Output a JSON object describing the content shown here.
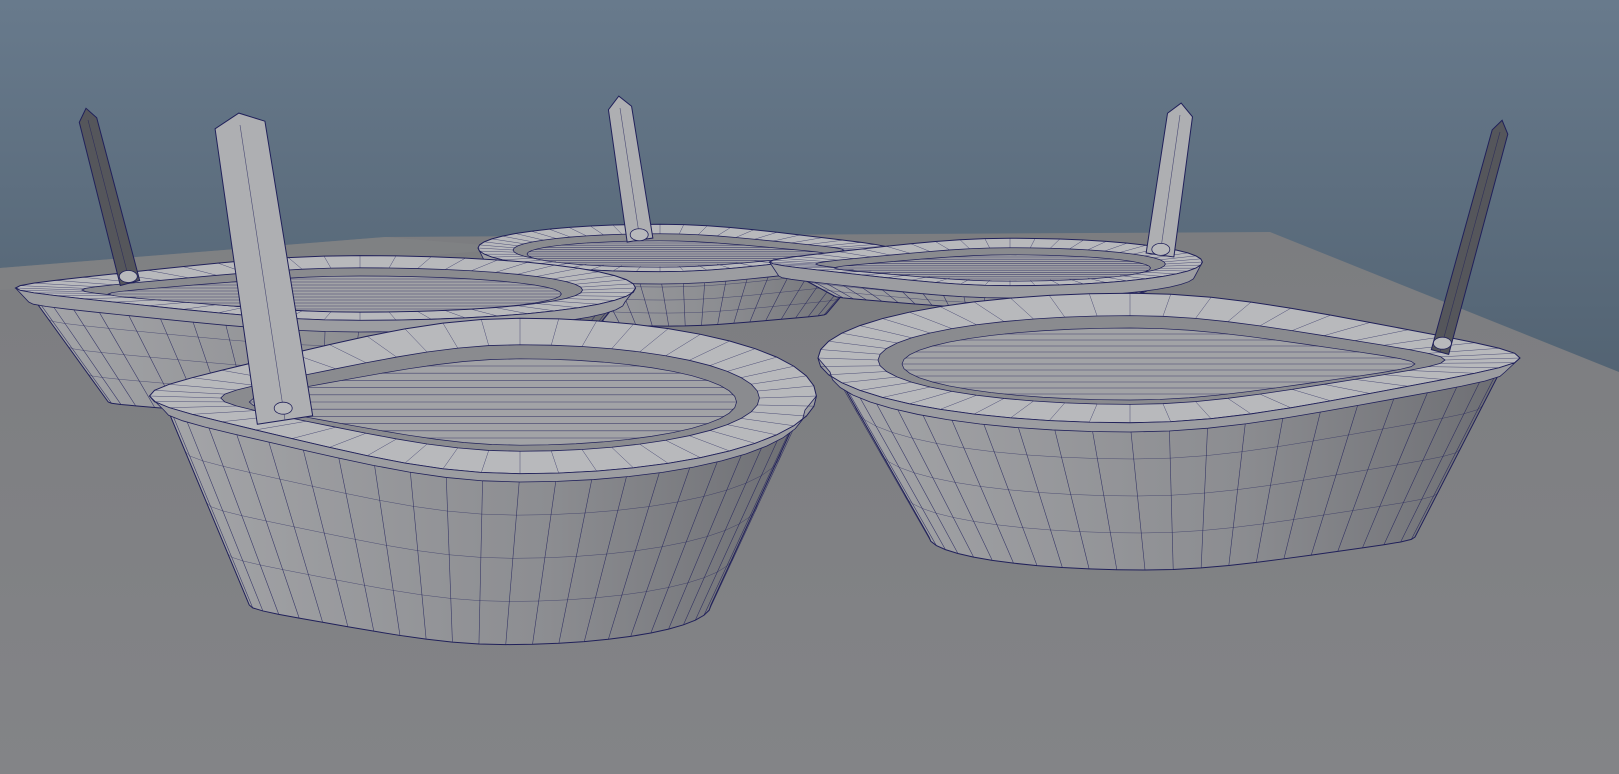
{
  "viewport": {
    "panel": "3d-viewport",
    "display_mode": "wireframe-on-shaded",
    "colors": {
      "sky_top": "#687a8c",
      "sky_bottom": "#3c4b58",
      "ground_light": "#8d8e91",
      "ground_dark": "#7c7d80",
      "hull_light": "#a9aaad",
      "hull_mid": "#8f9094",
      "hull_dark": "#6a6b70",
      "rim_light": "#b8b9bc",
      "wire": "#20205a",
      "oar_light": "#aeafb2",
      "oar_dark": "#55565b"
    },
    "objects": [
      {
        "name": "boat-front-left",
        "type": "rowboat-mesh"
      },
      {
        "name": "boat-back-left",
        "type": "rowboat-mesh"
      },
      {
        "name": "boat-back-center",
        "type": "rowboat-mesh"
      },
      {
        "name": "boat-back-right",
        "type": "rowboat-mesh"
      },
      {
        "name": "boat-front-right",
        "type": "rowboat-mesh"
      }
    ]
  }
}
